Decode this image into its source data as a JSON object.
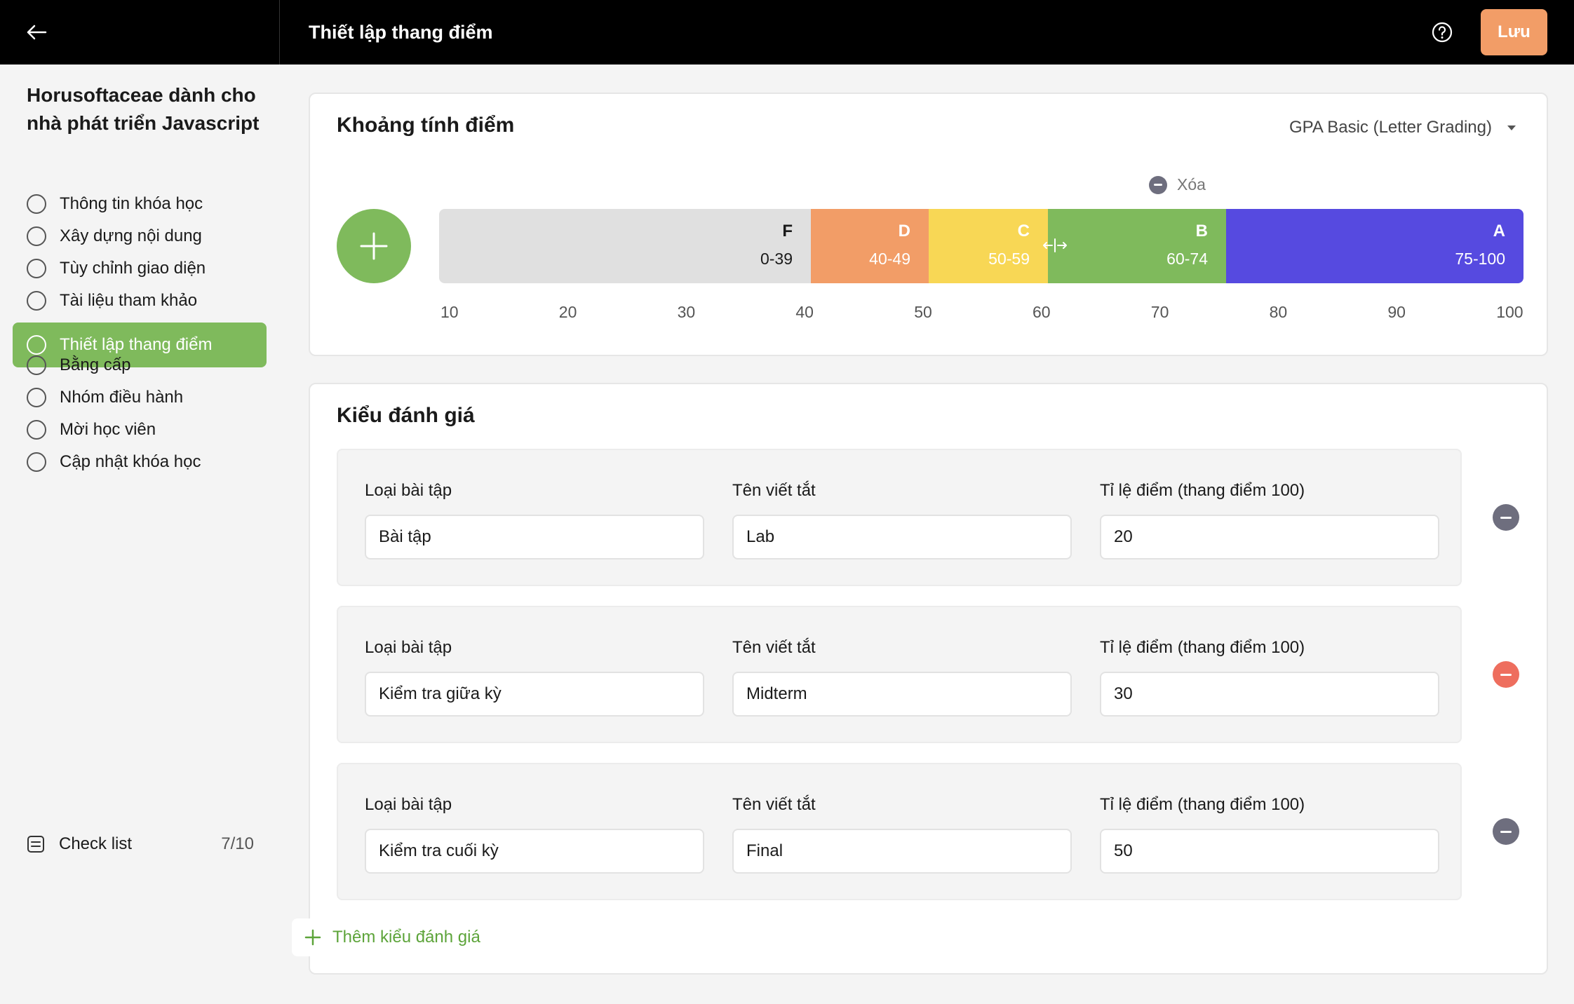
{
  "header": {
    "title": "Thiết lập thang điểm",
    "save_label": "Lưu"
  },
  "sidebar": {
    "course_title": "Horusoftaceae dành cho nhà phát triển Javascript",
    "items": [
      {
        "label": "Thông tin khóa học"
      },
      {
        "label": "Xây dựng nội dung"
      },
      {
        "label": "Tùy chỉnh giao diện"
      },
      {
        "label": "Tài liệu tham khảo"
      },
      {
        "label": "Thiết lập thang điểm"
      },
      {
        "label": "Bằng cấp"
      },
      {
        "label": "Nhóm điều hành"
      },
      {
        "label": "Mời học viên"
      },
      {
        "label": "Cập nhật khóa học"
      }
    ],
    "active_index": 4,
    "checklist": {
      "label": "Check list",
      "count": "7/10"
    }
  },
  "grading": {
    "title": "Khoảng tính điểm",
    "preset": "GPA Basic (Letter Grading)",
    "delete_label": "Xóa",
    "segments": [
      {
        "grade": "F",
        "range": "0-39",
        "color": "#e0e0e0",
        "text_color": "#1a1a1a"
      },
      {
        "grade": "D",
        "range": "40-49",
        "color": "#f29d67",
        "text_color": "#ffffff"
      },
      {
        "grade": "C",
        "range": "50-59",
        "color": "#f8d755",
        "text_color": "#ffffff"
      },
      {
        "grade": "B",
        "range": "60-74",
        "color": "#7fba5c",
        "text_color": "#ffffff"
      },
      {
        "grade": "A",
        "range": "75-100",
        "color": "#564ae0",
        "text_color": "#ffffff"
      }
    ],
    "ticks": [
      "10",
      "20",
      "30",
      "40",
      "50",
      "60",
      "70",
      "80",
      "90",
      "100"
    ]
  },
  "assessment": {
    "title": "Kiểu đánh giá",
    "labels": {
      "type": "Loại bài tập",
      "abbr": "Tên viết tắt",
      "weight": "Tỉ lệ điểm (thang điểm 100)"
    },
    "rows": [
      {
        "type": "Bài tập",
        "abbr": "Lab",
        "weight": "20",
        "remove_color": "#6e6e7e"
      },
      {
        "type": "Kiểm tra giữa kỳ",
        "abbr": "Midterm",
        "weight": "30",
        "remove_color": "#ee6e5e"
      },
      {
        "type": "Kiểm tra cuối kỳ",
        "abbr": "Final",
        "weight": "50",
        "remove_color": "#6e6e7e"
      }
    ],
    "add_label": "Thêm kiểu đánh giá"
  },
  "colors": {
    "accent_green": "#7fba5c",
    "save_orange": "#f29d67"
  }
}
